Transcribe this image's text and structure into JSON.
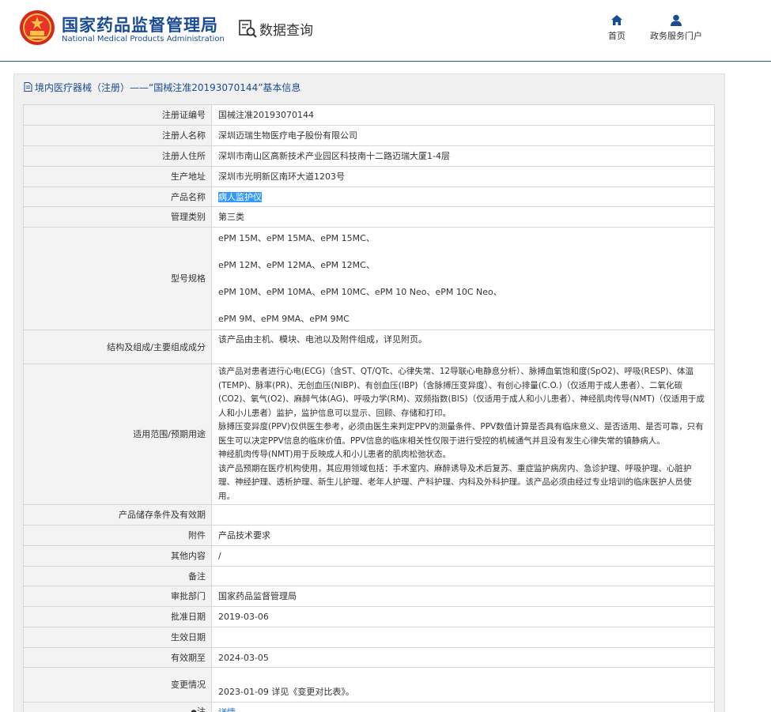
{
  "header": {
    "brand_cn": "国家药品监督管理局",
    "brand_en": "National Medical Products Administration",
    "data_query": "数据查询",
    "nav": [
      {
        "label": "首页",
        "icon": "home-icon"
      },
      {
        "label": "政务服务门户",
        "icon": "user-icon"
      }
    ]
  },
  "panel": {
    "title": "境内医疗器械（注册）——“国械注准20193070144”基本信息"
  },
  "rows": {
    "reg_no": {
      "label": "注册证编号",
      "value": "国械注准20193070144"
    },
    "registrant": {
      "label": "注册人名称",
      "value": "深圳迈瑞生物医疗电子股份有限公司"
    },
    "registrant_addr": {
      "label": "注册人住所",
      "value": "深圳市南山区高新技术产业园区科技南十二路迈瑞大厦1-4层"
    },
    "production_addr": {
      "label": "生产地址",
      "value": "深圳市光明新区南环大道1203号"
    },
    "product_name": {
      "label": "产品名称",
      "value": "病人监护仪"
    },
    "category": {
      "label": "管理类别",
      "value": "第三类"
    },
    "models": {
      "label": "型号规格",
      "lines": [
        "ePM 15M、ePM 15MA、ePM 15MC、",
        "ePM 12M、ePM 12MA、ePM 12MC、",
        "ePM 10M、ePM 10MA、ePM 10MC、ePM 10 Neo、ePM 10C Neo、",
        "ePM 9M、ePM 9MA、ePM 9MC"
      ]
    },
    "structure": {
      "label": "结构及组成/主要组成成分",
      "value": "该产品由主机、模块、电池以及附件组成，详见附页。"
    },
    "scope": {
      "label": "适用范围/预期用途",
      "value": "该产品对患者进行心电(ECG)（含ST、QT/QTc、心律失常、12导联心电静息分析）、脉搏血氧饱和度(SpO2)、呼吸(RESP)、体温(TEMP)、脉率(PR)、无创血压(NIBP)、有创血压(IBP)（含脉搏压变异度）、有创心排量(C.O.)（仅适用于成人患者）、二氧化碳(CO2)、氧气(O2)、麻醉气体(AG)、呼吸力学(RM)、双频指数(BIS)（仅适用于成人和小儿患者）、神经肌肉传导(NMT)（仅适用于成人和小儿患者）监护，监护信息可以显示、回顾、存储和打印。\n脉搏压变异度(PPV)仅供医生参考，必须由医生来判定PPV的测量条件、PPV数值计算是否具有临床意义、是否适用、是否可靠，只有医生可以决定PPV信息的临床价值。PPV信息的临床相关性仅限于进行受控的机械通气并且没有发生心律失常的镇静病人。\n神经肌肉传导(NMT)用于反映成人和小儿患者的肌肉松弛状态。\n该产品预期在医疗机构使用，其应用领域包括：手术室内、麻醉诱导及术后复苏、重症监护病房内、急诊护理、呼吸护理、心脏护理、神经护理、透析护理、新生儿护理、老年人护理、产科护理、内科及外科护理。该产品必须由经过专业培训的临床医护人员使用。"
    },
    "storage": {
      "label": "产品储存条件及有效期",
      "value": ""
    },
    "attachment": {
      "label": "附件",
      "value": "产品技术要求"
    },
    "other": {
      "label": "其他内容",
      "value": "/"
    },
    "remark": {
      "label": "备注",
      "value": ""
    },
    "approval_dept": {
      "label": "审批部门",
      "value": "国家药品监督管理局"
    },
    "approval_date": {
      "label": "批准日期",
      "value": "2019-03-06"
    },
    "effective_date": {
      "label": "生效日期",
      "value": ""
    },
    "valid_until": {
      "label": "有效期至",
      "value": "2024-03-05"
    },
    "change": {
      "label": "变更情况",
      "value": "2023-01-09 详见《变更对比表》。"
    },
    "note": {
      "label": "注",
      "link": "详情"
    }
  }
}
